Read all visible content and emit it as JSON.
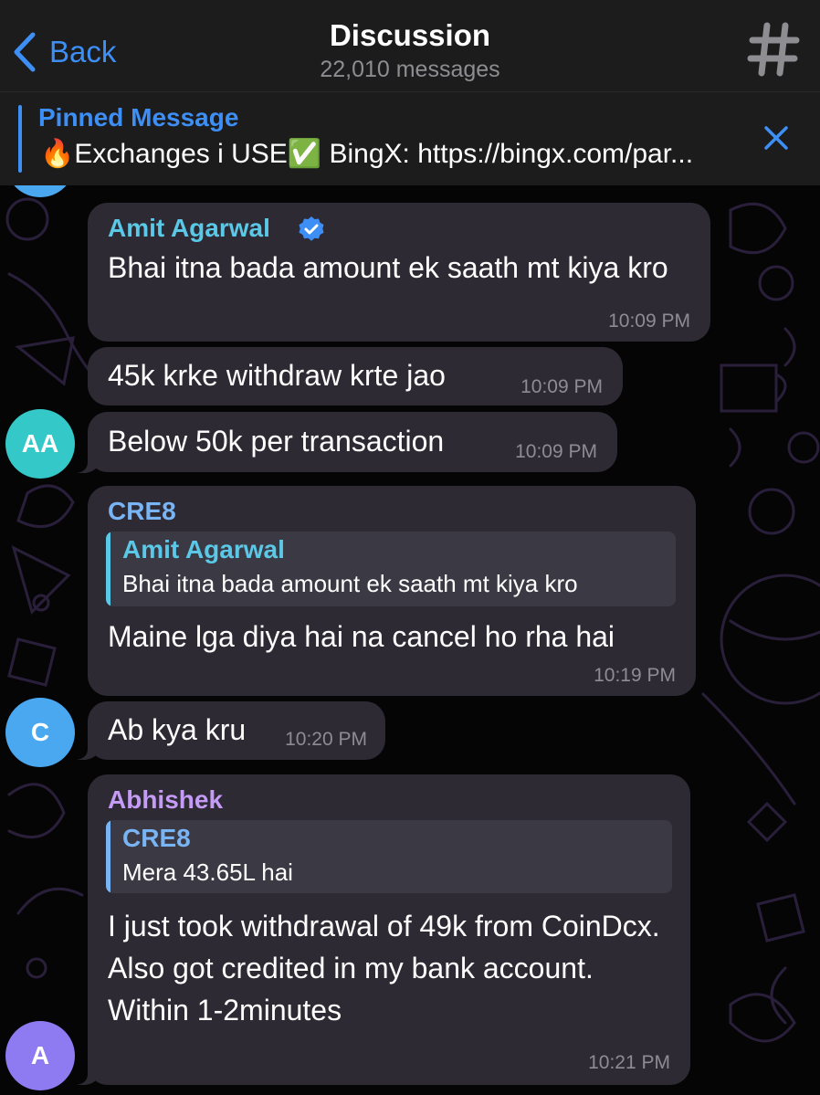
{
  "header": {
    "back_label": "Back",
    "title": "Discussion",
    "subtitle": "22,010 messages"
  },
  "pinned": {
    "title": "Pinned Message",
    "text": "🔥Exchanges i USE✅ BingX: https://bingx.com/par..."
  },
  "colors": {
    "accent": "#3d8ff5",
    "bubble": "#2d2a33",
    "sender_amit": "#5ac8e6",
    "sender_cre8": "#79b4f5",
    "sender_abhishek": "#c49bf5",
    "avatar_aa": "#35c8c8",
    "avatar_c": "#4aa8f0",
    "avatar_a": "#8e7bf2"
  },
  "messages": [
    {
      "sender": "Amit Agarwal",
      "verified": true,
      "text": "Bhai itna bada amount ek saath mt kiya kro",
      "time": "10:09 PM"
    },
    {
      "text": "45k krke withdraw krte jao",
      "time": "10:09 PM"
    },
    {
      "text": "Below 50k per transaction",
      "time": "10:09 PM",
      "avatar": "AA"
    },
    {
      "sender": "CRE8",
      "reply": {
        "name": "Amit Agarwal",
        "text": "Bhai itna bada amount ek saath mt kiya kro"
      },
      "text": "Maine lga diya hai na cancel ho rha hai",
      "time": "10:19 PM"
    },
    {
      "text": "Ab kya kru",
      "time": "10:20 PM",
      "avatar": "C"
    },
    {
      "sender": "Abhishek",
      "reply": {
        "name": "CRE8",
        "text": "Mera 43.65L hai"
      },
      "text": "I just took withdrawal of 49k from CoinDcx.\nAlso got credited in my bank account. Within 1-2minutes",
      "time": "10:21 PM",
      "avatar": "A"
    }
  ]
}
